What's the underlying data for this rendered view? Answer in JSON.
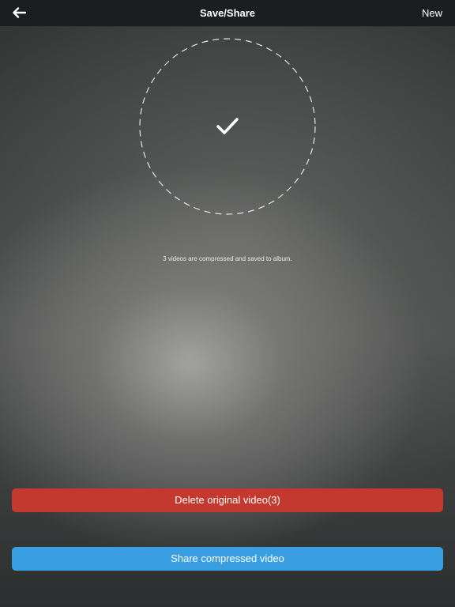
{
  "header": {
    "title": "Save/Share",
    "new_label": "New",
    "back_icon": "arrow-left-icon"
  },
  "status": {
    "icon": "checkmark-icon",
    "message": "3 videos are compressed and saved to album."
  },
  "actions": {
    "delete_label": "Delete original video(3)",
    "share_label": "Share compressed video"
  },
  "colors": {
    "delete_button": "#c4392f",
    "share_button": "#3a9ee2",
    "topbar": "#1c1d1f"
  }
}
